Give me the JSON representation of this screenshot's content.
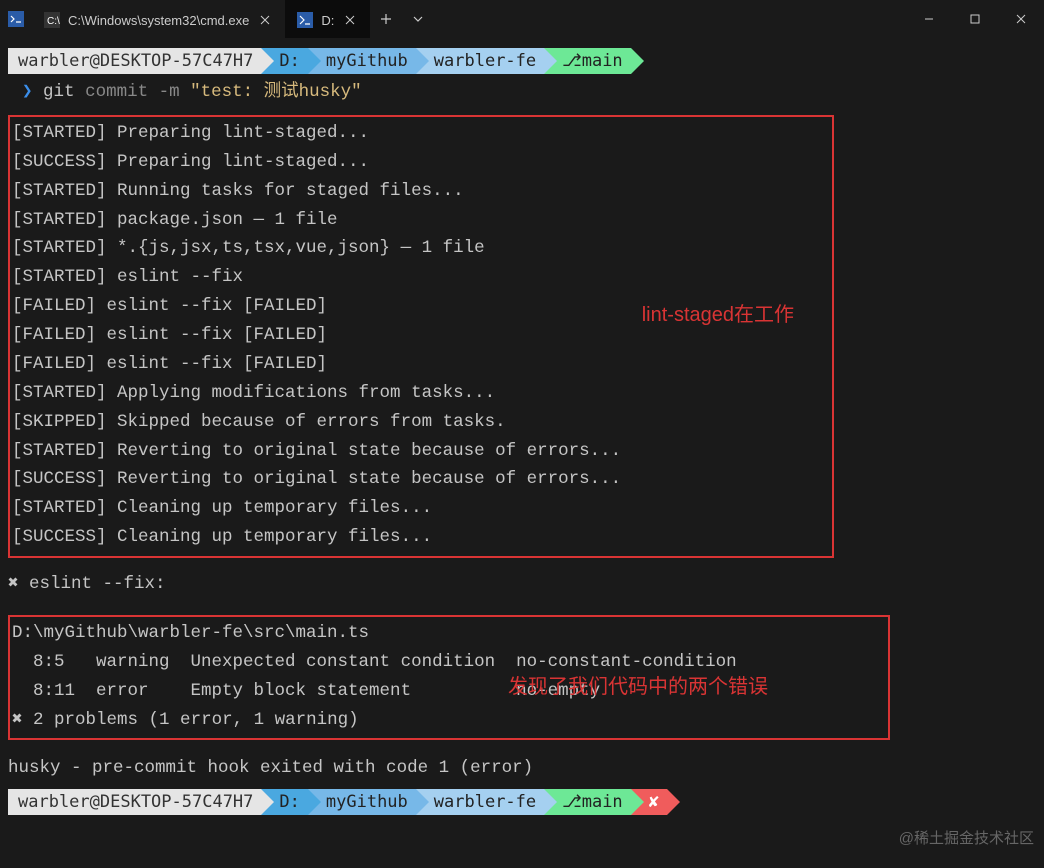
{
  "tabs": [
    {
      "title": "C:\\Windows\\system32\\cmd.exe"
    },
    {
      "title": "D:"
    }
  ],
  "breadcrumb1": {
    "user": "warbler@DESKTOP-57C47H7",
    "drive": "D:",
    "path1": "myGithub",
    "path2": "warbler-fe",
    "branch": "⎇main"
  },
  "command": {
    "git": "git",
    "sub": "commit",
    "flag": "-m",
    "str": "\"test: 测试husky\""
  },
  "lint_output": [
    "[STARTED] Preparing lint-staged...",
    "[SUCCESS] Preparing lint-staged...",
    "[STARTED] Running tasks for staged files...",
    "[STARTED] package.json — 1 file",
    "[STARTED] *.{js,jsx,ts,tsx,vue,json} — 1 file",
    "[STARTED] eslint --fix",
    "[FAILED] eslint --fix [FAILED]",
    "[FAILED] eslint --fix [FAILED]",
    "[FAILED] eslint --fix [FAILED]",
    "[STARTED] Applying modifications from tasks...",
    "[SKIPPED] Skipped because of errors from tasks.",
    "[STARTED] Reverting to original state because of errors...",
    "[SUCCESS] Reverting to original state because of errors...",
    "[STARTED] Cleaning up temporary files...",
    "[SUCCESS] Cleaning up temporary files..."
  ],
  "annotation1": "lint-staged在工作",
  "eslint_heading": "✖ eslint --fix:",
  "eslint_output": [
    "D:\\myGithub\\warbler-fe\\src\\main.ts",
    "  8:5   warning  Unexpected constant condition  no-constant-condition",
    "  8:11  error    Empty block statement          no-empty",
    "",
    "✖ 2 problems (1 error, 1 warning)"
  ],
  "annotation2": "发现了我们代码中的两个错误",
  "husky_line": "husky - pre-commit hook exited with code 1 (error)",
  "breadcrumb2": {
    "user": "warbler@DESKTOP-57C47H7",
    "drive": "D:",
    "path1": "myGithub",
    "path2": "warbler-fe",
    "branch": "⎇main",
    "err": "✘"
  },
  "watermark": "@稀土掘金技术社区"
}
